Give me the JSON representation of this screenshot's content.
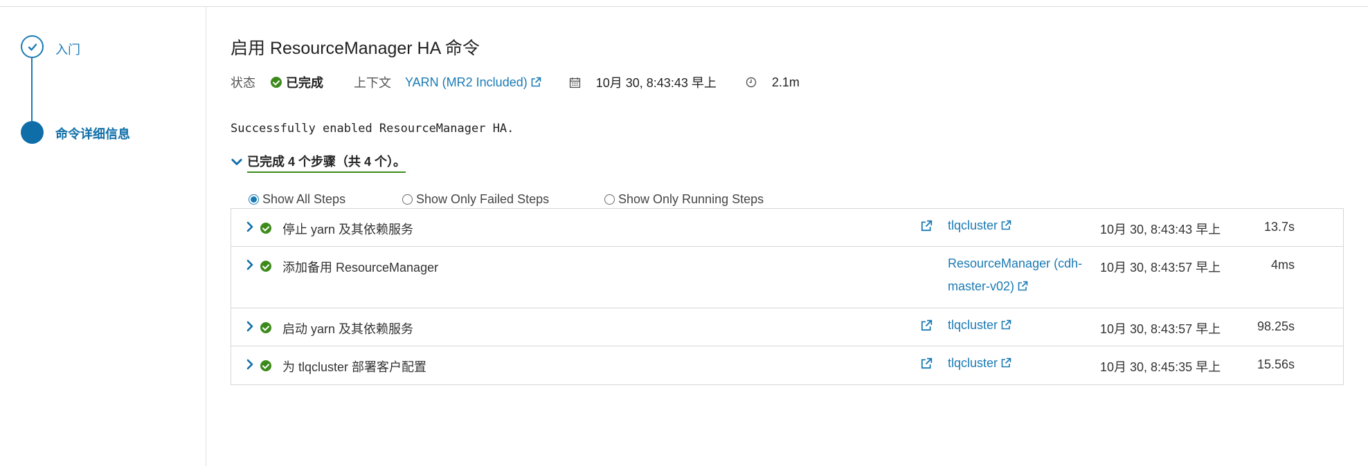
{
  "wizard": {
    "steps": [
      {
        "label": "入门",
        "state": "done"
      },
      {
        "label": "命令详细信息",
        "state": "current"
      }
    ]
  },
  "command": {
    "title": "启用 ResourceManager HA 命令",
    "status_label": "状态",
    "status_value": "已完成",
    "context_label": "上下文",
    "context_value": "YARN (MR2 Included)",
    "start_time": "10月 30, 8:43:43 早上",
    "duration": "2.1m",
    "message": "Successfully enabled ResourceManager HA.",
    "summary": "已完成 4 个步骤（共 4 个）。"
  },
  "filters": [
    {
      "label": "Show All Steps",
      "selected": true
    },
    {
      "label": "Show Only Failed Steps",
      "selected": false
    },
    {
      "label": "Show Only Running Steps",
      "selected": false
    }
  ],
  "steps": [
    {
      "name": "停止 yarn 及其依赖服务",
      "has_ext": true,
      "target": "tlqcluster",
      "time": "10月 30, 8:43:43 早上",
      "duration": "13.7s"
    },
    {
      "name": "添加备用 ResourceManager",
      "has_ext": false,
      "target": "ResourceManager (cdh-master-v02)",
      "time": "10月 30, 8:43:57 早上",
      "duration": "4ms"
    },
    {
      "name": "启动 yarn 及其依赖服务",
      "has_ext": true,
      "target": "tlqcluster",
      "time": "10月 30, 8:43:57 早上",
      "duration": "98.25s"
    },
    {
      "name": "为 tlqcluster 部署客户配置",
      "has_ext": true,
      "target": "tlqcluster",
      "time": "10月 30, 8:45:35 早上",
      "duration": "15.56s"
    }
  ],
  "colors": {
    "link": "#1a7ab5",
    "success": "#3c8b1a",
    "current_step": "#0f6ea8"
  }
}
